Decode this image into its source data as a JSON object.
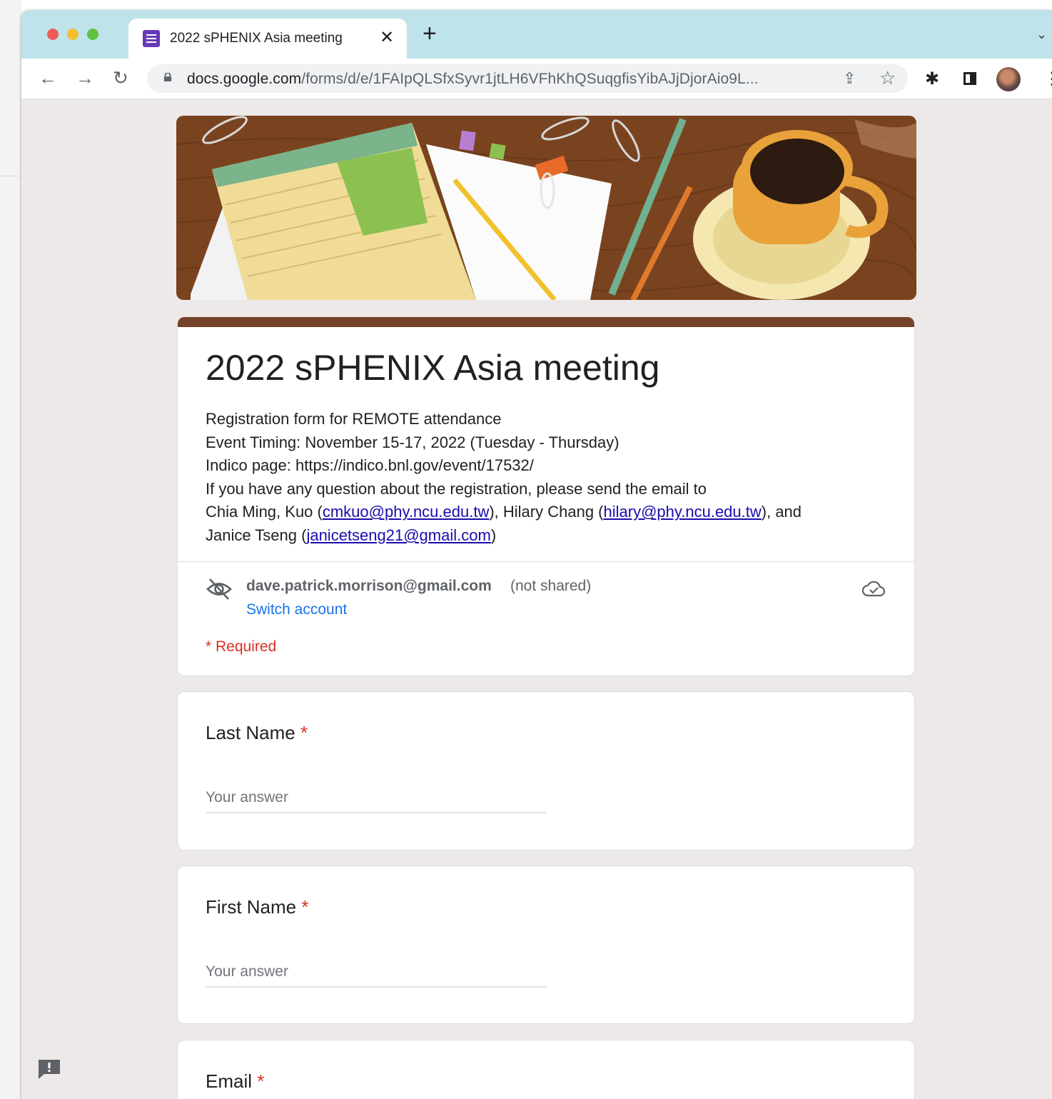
{
  "browser": {
    "tab_title": "2022 sPHENIX Asia meeting",
    "tab_close": "✕",
    "new_tab": "+",
    "url_domain": "docs.google.com",
    "url_path": "/forms/d/e/1FAIpQLSfxSyvr1jtLH6VFhKhQSuqgfisYibAJjDjorAio9L...",
    "colors": {
      "tab_strip": "#bfe3ea",
      "close": "#ee5b55",
      "minimize": "#f5be2f",
      "zoom": "#5dc23f"
    }
  },
  "form": {
    "title": "2022 sPHENIX Asia meeting",
    "description": {
      "line1": "Registration form for REMOTE attendance",
      "line2": "Event Timing: November 15-17, 2022 (Tuesday - Thursday)",
      "line3": "Indico page: https://indico.bnl.gov/event/17532/",
      "line4": "If you have any question about the registration, please send the email to",
      "contact1_name": "Chia Ming, Kuo (",
      "contact1_email": "cmkuo@phy.ncu.edu.tw",
      "contact2_name": "), Hilary Chang (",
      "contact2_email": "hilary@phy.ncu.edu.tw",
      "sep_and": "), and",
      "contact3_name": "Janice Tseng (",
      "contact3_email": "janicetseng21@gmail.com",
      "close_paren": ")"
    },
    "account": {
      "email": "dave.patrick.morrison@gmail.com",
      "note": "(not shared)",
      "switch_label": "Switch account"
    },
    "required_note": "* Required",
    "accent_color": "#754228",
    "questions": [
      {
        "label": "Last Name",
        "required_mark": "*",
        "placeholder": "Your answer"
      },
      {
        "label": "First Name",
        "required_mark": "*",
        "placeholder": "Your answer"
      },
      {
        "label": "Email",
        "required_mark": "*"
      }
    ]
  }
}
